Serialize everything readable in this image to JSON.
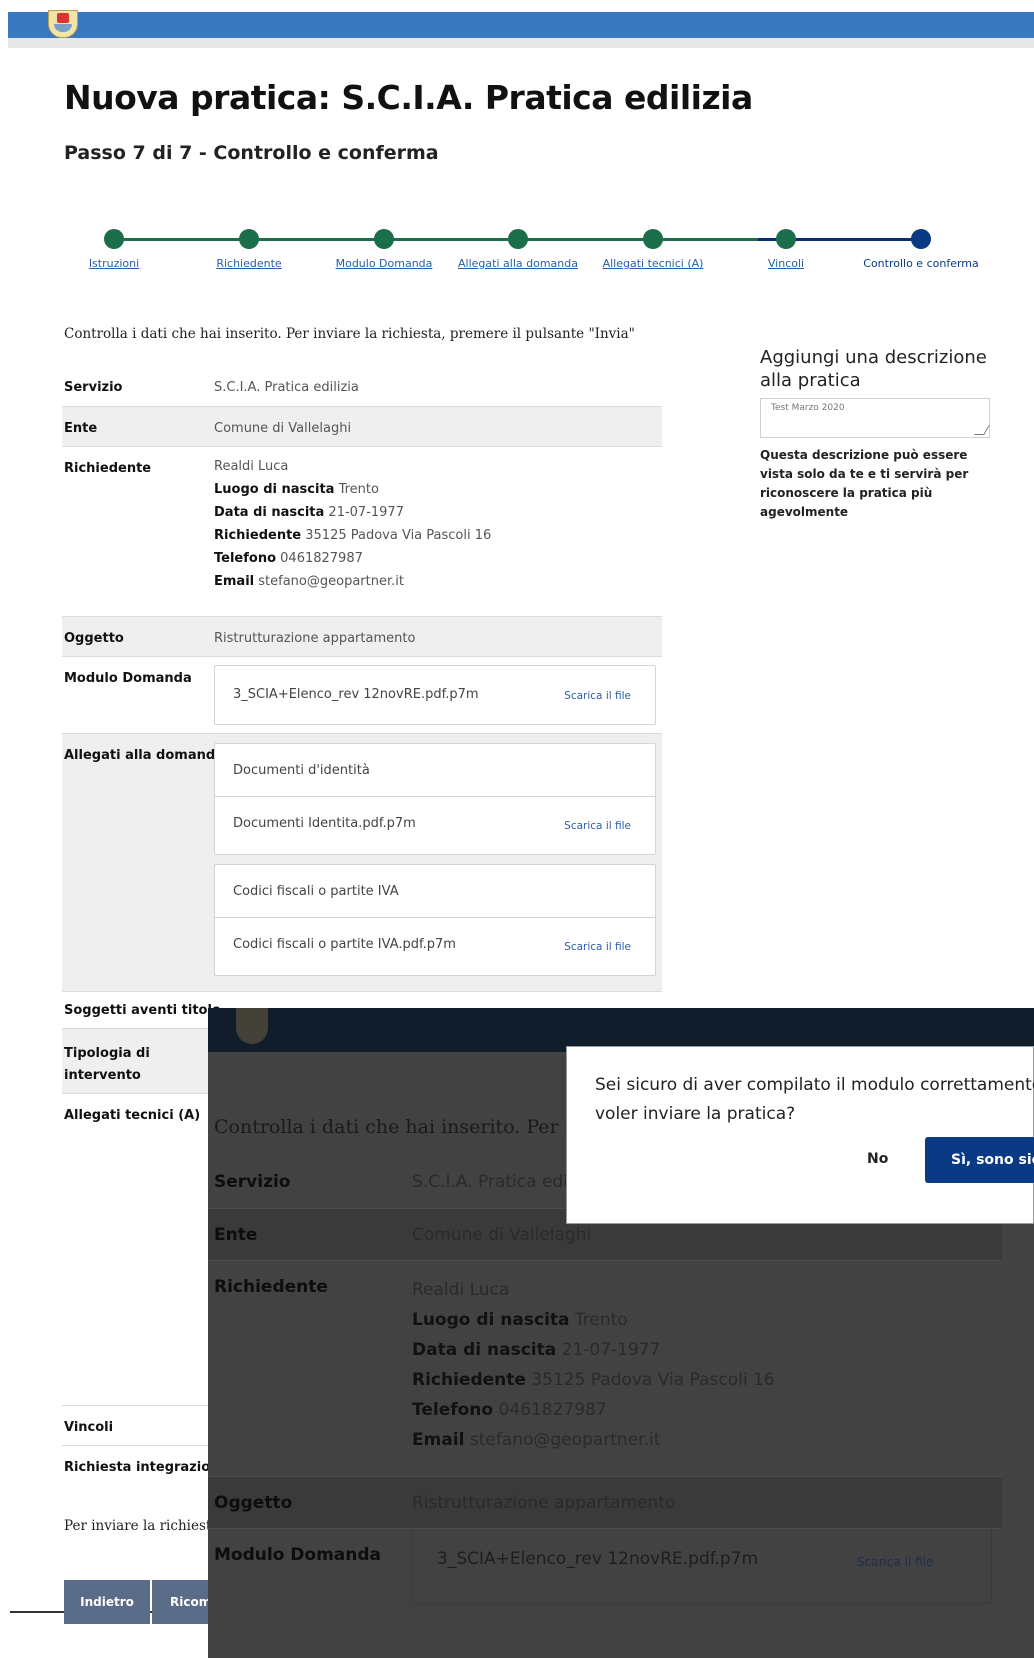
{
  "page": {
    "title": "Nuova pratica: S.C.I.A. Pratica edilizia",
    "subtitle": "Passo 7 di 7 - Controllo e conferma"
  },
  "steps": [
    {
      "label": "Istruzioni",
      "done": true
    },
    {
      "label": "Richiedente",
      "done": true
    },
    {
      "label": "Modulo Domanda",
      "done": true
    },
    {
      "label": "Allegati alla domanda",
      "done": true
    },
    {
      "label": "Allegati tecnici (A)",
      "done": true
    },
    {
      "label": "Vincoli",
      "done": true
    },
    {
      "label": "Controllo e conferma",
      "done": false
    }
  ],
  "intro": "Controlla i dati che hai inserito. Per inviare la richiesta, premere il pulsante \"Invia\"",
  "summary": {
    "servizio_label": "Servizio",
    "servizio_value": "S.C.I.A. Pratica edilizia",
    "ente_label": "Ente",
    "ente_value": "Comune di Vallelaghi",
    "richiedente_label": "Richiedente",
    "richiedente_name": "Realdi Luca",
    "luogo_label": "Luogo di nascita",
    "luogo_value": "Trento",
    "data_label": "Data di nascita",
    "data_value": "21-07-1977",
    "indirizzo_label": "Richiedente",
    "indirizzo_value": "35125 Padova Via Pascoli 16",
    "telefono_label": "Telefono",
    "telefono_value": "0461827987",
    "email_label": "Email",
    "email_value": "stefano@geopartner.it",
    "oggetto_label": "Oggetto",
    "oggetto_value": "Ristrutturazione appartamento",
    "modulo_label": "Modulo Domanda",
    "modulo_file": "3_SCIA+Elenco_rev 12novRE.pdf.p7m",
    "allegati_label": "Allegati alla domanda",
    "allegato1_title": "Documenti d'identità",
    "allegato1_file": "Documenti Identita.pdf.p7m",
    "allegato2_title": "Codici fiscali o partite IVA",
    "allegato2_file": "Codici fiscali o partite IVA.pdf.p7m",
    "download_label": "Scarica il file",
    "soggetti_label": "Soggetti aventi titolo",
    "tipologia_label": "Tipologia di intervento",
    "allegati_tecnici_label": "Allegati tecnici (A)",
    "vincoli_label": "Vincoli",
    "integrazioni_label": "Richiesta integrazioni"
  },
  "side": {
    "title": "Aggiungi una descrizione alla pratica",
    "description_value": "Test Marzo 2020",
    "hint": "Questa descrizione può essere vista solo da te e ti servirà per riconoscere la pratica più agevolmente"
  },
  "outro": "Per inviare la richiest",
  "buttons": {
    "back": "Indietro",
    "reset": "Ricom"
  },
  "overlay": {
    "intro": "Controlla i dati che hai inserito. Per inv",
    "servizio_value": "S.C.I.A. Pratica ediliz"
  },
  "dialog": {
    "question_line1": "Sei sicuro di aver compilato il modulo correttamente e",
    "question_line2": "voler inviare la pratica?",
    "no_label": "No",
    "yes_label": "Sì, sono sic"
  }
}
